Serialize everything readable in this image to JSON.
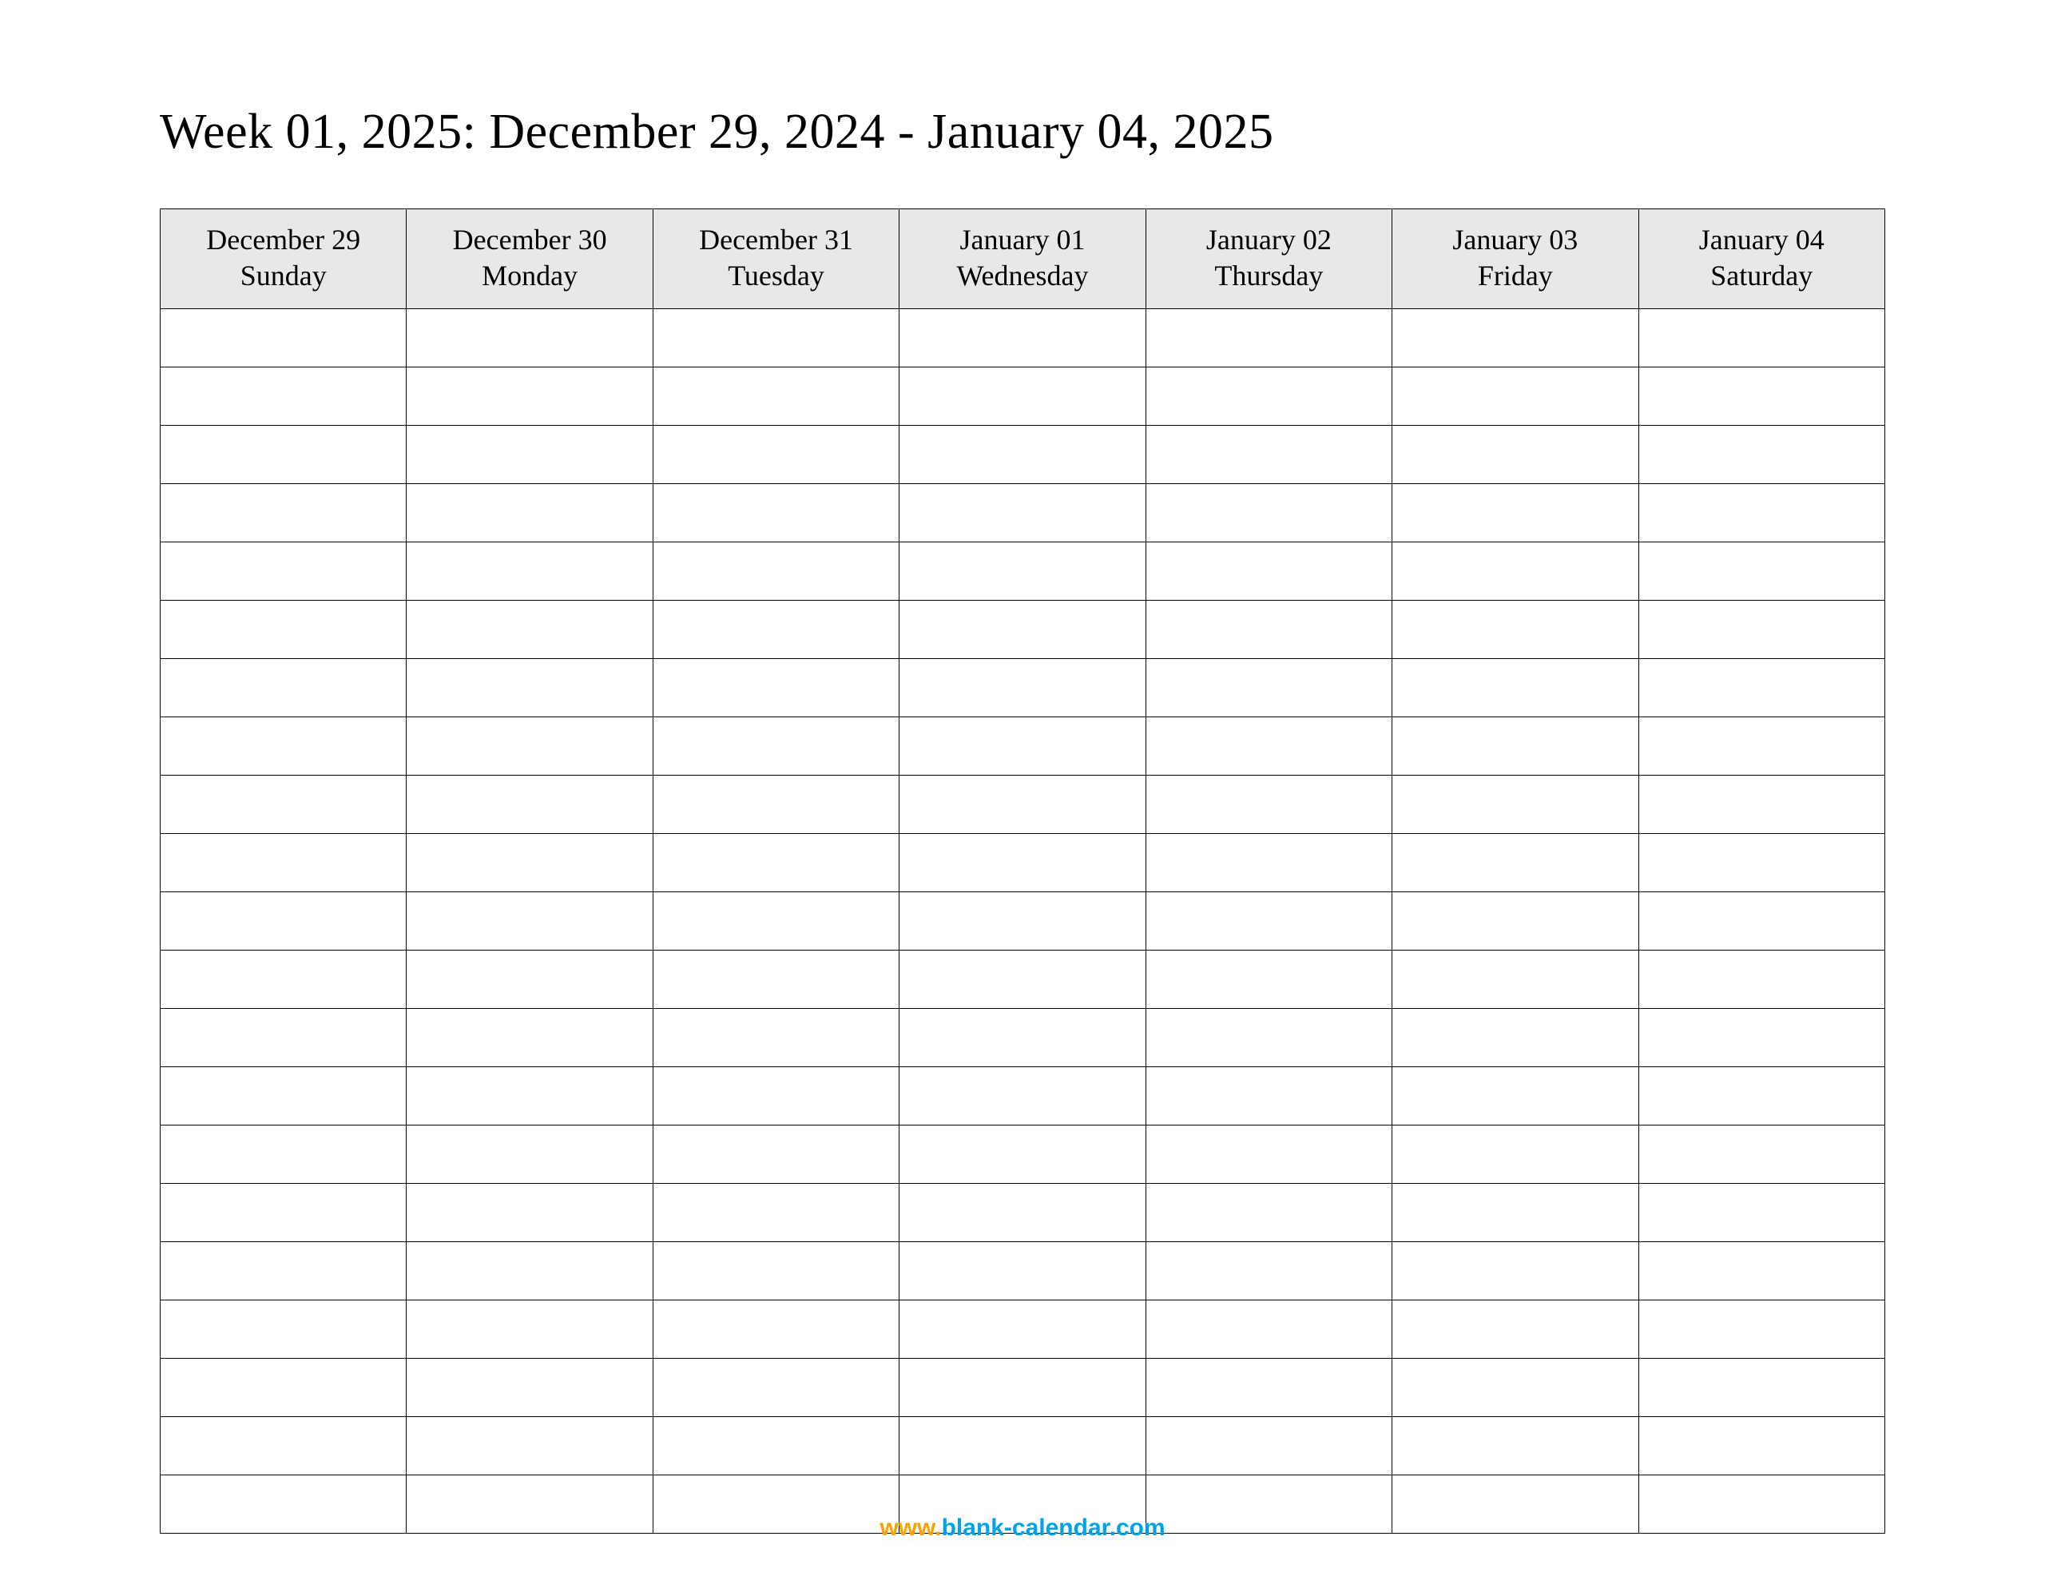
{
  "title": "Week 01, 2025: December 29, 2024 - January 04, 2025",
  "columns": [
    {
      "date": "December 29",
      "day": "Sunday"
    },
    {
      "date": "December 30",
      "day": "Monday"
    },
    {
      "date": "December 31",
      "day": "Tuesday"
    },
    {
      "date": "January 01",
      "day": "Wednesday"
    },
    {
      "date": "January 02",
      "day": "Thursday"
    },
    {
      "date": "January 03",
      "day": "Friday"
    },
    {
      "date": "January 04",
      "day": "Saturday"
    }
  ],
  "row_count": 21,
  "footer": {
    "prefix": "www.",
    "domain": "blank-calendar.com"
  }
}
